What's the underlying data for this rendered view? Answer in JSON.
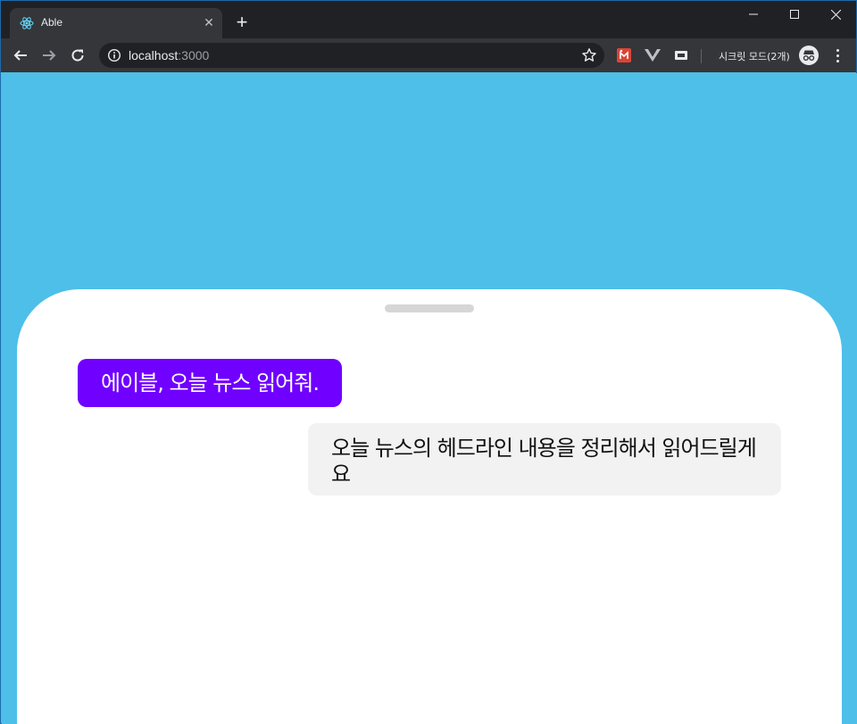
{
  "browser": {
    "tab": {
      "title": "Able"
    },
    "address": {
      "host": "localhost",
      "port": ":3000"
    },
    "incognito_label": "시크릿 모드(2개)"
  },
  "chat": {
    "messages": [
      {
        "role": "user",
        "text": "에이블, 오늘 뉴스 읽어줘."
      },
      {
        "role": "assistant",
        "text": "오늘 뉴스의 헤드라인 내용을 정리해서 읽어드릴게요"
      }
    ]
  },
  "colors": {
    "page_background": "#4dbfe8",
    "user_bubble": "#7000ff",
    "assistant_bubble": "#f2f2f2"
  },
  "icons": [
    "react-favicon-icon",
    "close-icon",
    "plus-icon",
    "minimize-icon",
    "maximize-icon",
    "window-close-icon",
    "back-arrow-icon",
    "forward-arrow-icon",
    "reload-icon",
    "info-icon",
    "star-icon",
    "extension-icon",
    "vue-devtools-icon",
    "cast-icon",
    "incognito-icon",
    "more-vert-icon"
  ]
}
